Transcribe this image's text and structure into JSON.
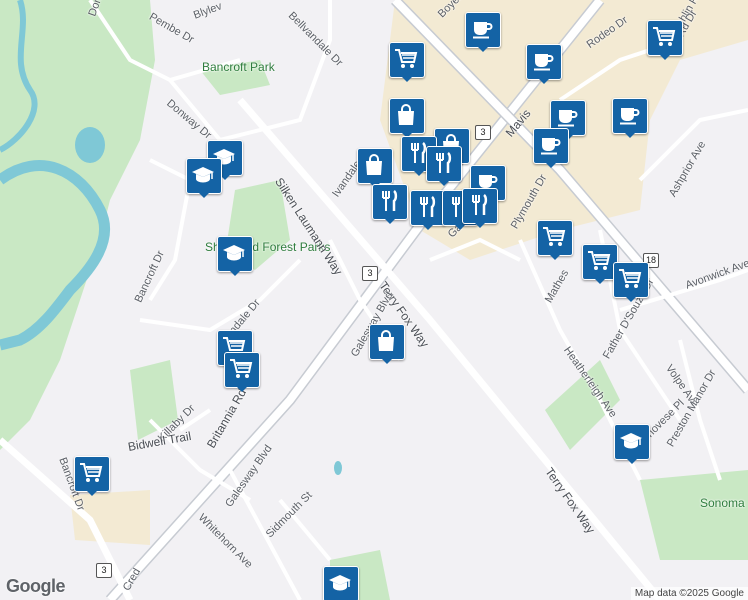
{
  "map": {
    "logo": "Google",
    "attribution": "Map data ©2025 Google",
    "colors": {
      "background": "#f2f1f4",
      "park": "#c9e8c4",
      "water": "#7fc8d6",
      "commercial": "#f3ead3",
      "arterial": "#c7cbd2",
      "marker": "#1463a5"
    },
    "parks": [
      "Bancroft Park",
      "Sherwood Forest Parks",
      "Sonoma"
    ],
    "streets": [
      "Donway Dr",
      "Donway Dr",
      "Pembe Dr",
      "Blylev",
      "Bellvandale Dr",
      "Boyer Blvd",
      "Rodeo Dr",
      "Laughlin Rd",
      "Mavis",
      "Ivandale",
      "Silken Laumann Way",
      "Plymouth Dr",
      "Ashprior Ave",
      "Terry Fox Way",
      "Terry Fox Way",
      "Mathes",
      "Avonwick Ave",
      "Heatherleigh Ave",
      "Father D'Souza Dr",
      "Volpe Ave",
      "Bancroft Dr",
      "Ivandale Dr",
      "Galesway Blvd",
      "Britannia Rd W",
      "Killaby Dr",
      "Bidwell Trail",
      "Genovese Pl",
      "Preston Manor Dr",
      "Galesway Blvd",
      "Whitehorn Ave",
      "Sidmouth St",
      "Bancroft Dr",
      "Cred",
      "Gales Dr",
      "Rd Dr"
    ],
    "route_shields": [
      "3",
      "3",
      "3",
      "18"
    ],
    "markers": [
      {
        "icon": "coffee-icon"
      },
      {
        "icon": "coffee-icon"
      },
      {
        "icon": "coffee-icon"
      },
      {
        "icon": "coffee-icon"
      },
      {
        "icon": "coffee-icon"
      },
      {
        "icon": "coffee-icon"
      },
      {
        "icon": "cart-icon"
      },
      {
        "icon": "cart-icon"
      },
      {
        "icon": "cart-icon"
      },
      {
        "icon": "cart-icon"
      },
      {
        "icon": "cart-icon"
      },
      {
        "icon": "cart-icon"
      },
      {
        "icon": "cart-icon"
      },
      {
        "icon": "cart-icon"
      },
      {
        "icon": "bag-icon"
      },
      {
        "icon": "bag-icon"
      },
      {
        "icon": "bag-icon"
      },
      {
        "icon": "bag-icon"
      },
      {
        "icon": "fork-knife-icon"
      },
      {
        "icon": "fork-knife-icon"
      },
      {
        "icon": "fork-knife-icon"
      },
      {
        "icon": "fork-knife-icon"
      },
      {
        "icon": "fork-knife-icon"
      },
      {
        "icon": "fork-knife-icon"
      },
      {
        "icon": "school-icon"
      },
      {
        "icon": "school-icon"
      },
      {
        "icon": "school-icon"
      },
      {
        "icon": "school-icon"
      },
      {
        "icon": "school-icon"
      }
    ]
  }
}
